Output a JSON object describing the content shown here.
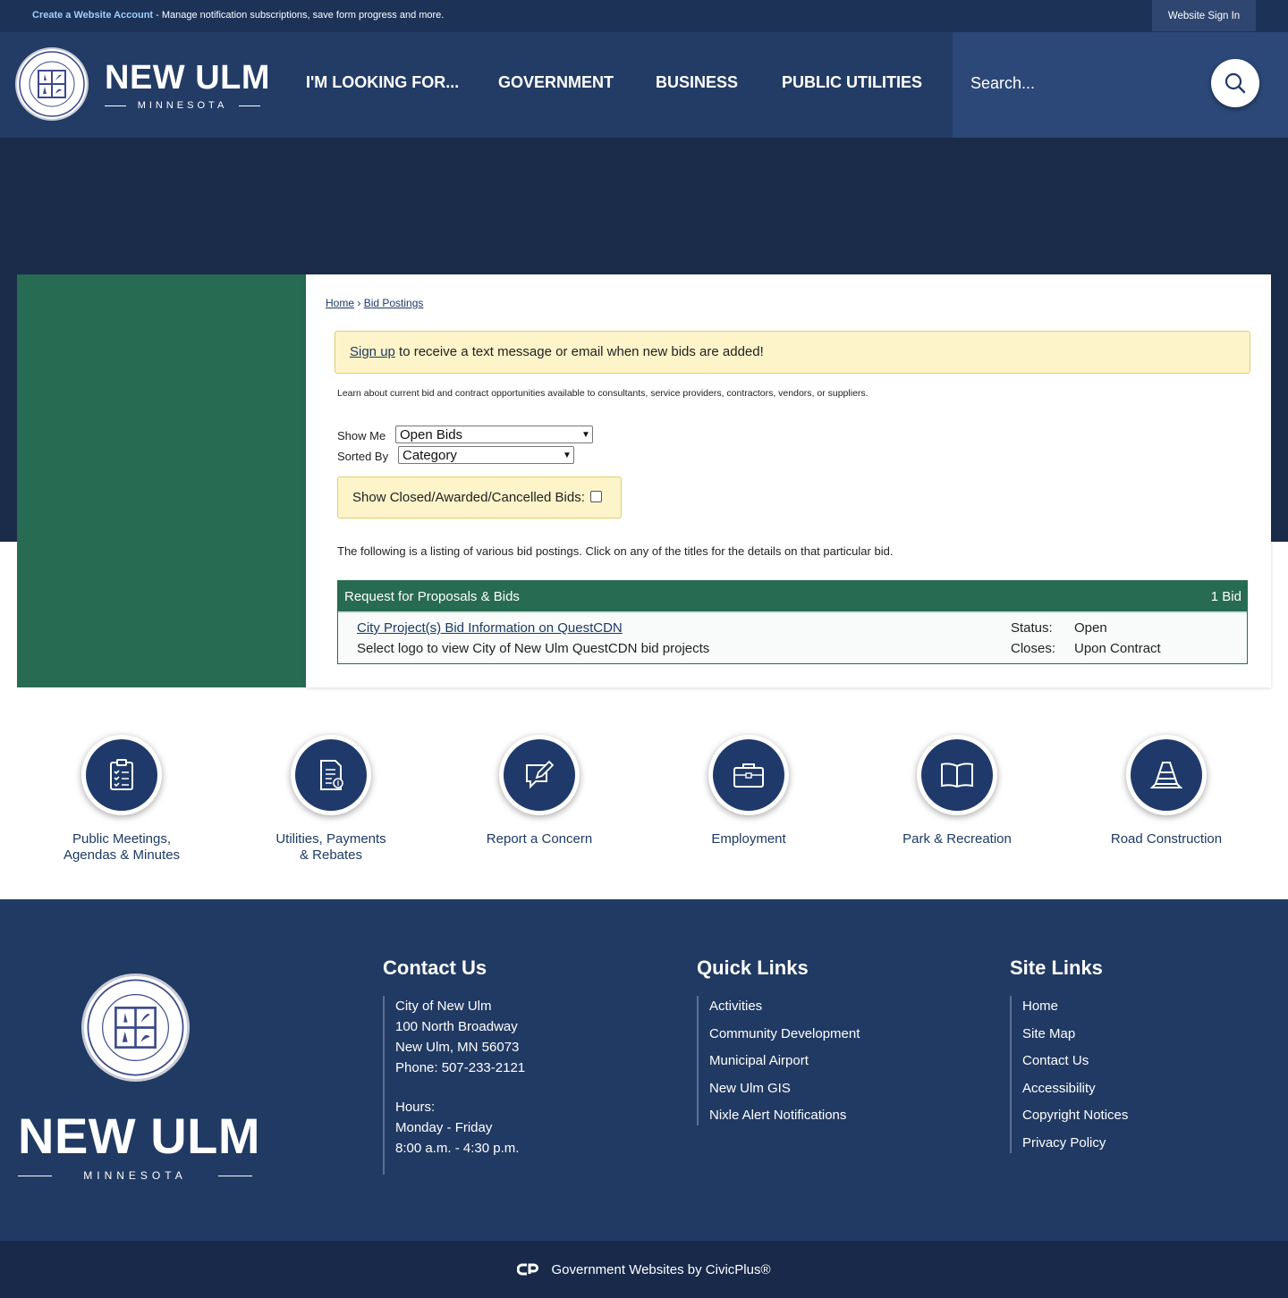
{
  "topbar": {
    "account_link": "Create a Website Account",
    "account_desc": " - Manage notification subscriptions, save form progress and more.",
    "signin": "Website Sign In"
  },
  "header": {
    "brand_name": "NEW ULM",
    "brand_sub": "MINNESOTA",
    "nav": [
      "I'M LOOKING FOR...",
      "GOVERNMENT",
      "BUSINESS",
      "PUBLIC UTILITIES"
    ],
    "search_placeholder": "Search..."
  },
  "breadcrumb": {
    "home": "Home",
    "current": "Bid Postings",
    "separator": "›"
  },
  "notice": {
    "link": "Sign up",
    "text": " to receive a text message or email when new bids are added!"
  },
  "intro": "Learn about current bid and contract opportunities available to consultants, service providers, contractors, vendors, or suppliers.",
  "filters": {
    "show_me_label": "Show Me",
    "show_me_value": "Open Bids",
    "sorted_by_label": "Sorted By",
    "sorted_by_value": "Category",
    "closed_label": "Show Closed/Awarded/Cancelled Bids:"
  },
  "listing_text": "The following is a listing of various bid postings. Click on any of the titles for the details on that particular bid.",
  "bids": {
    "category": "Request for Proposals & Bids",
    "count": "1 Bid",
    "item": {
      "title": "City Project(s) Bid Information on QuestCDN",
      "desc": "Select logo to view City of New Ulm QuestCDN bid projects",
      "status_label": "Status:",
      "status_value": "Open",
      "closes_label": "Closes:",
      "closes_value": "Upon Contract"
    }
  },
  "quick_icons": [
    {
      "line1": "Public Meetings,",
      "line2": "Agendas & Minutes",
      "icon": "clipboard-checklist-icon"
    },
    {
      "line1": "Utilities, Payments",
      "line2": "& Rebates",
      "icon": "bill-document-icon"
    },
    {
      "line1": "Report a Concern",
      "line2": "",
      "icon": "edit-message-icon"
    },
    {
      "line1": "Employment",
      "line2": "",
      "icon": "briefcase-icon"
    },
    {
      "line1": "Park & Recreation",
      "line2": "",
      "icon": "book-icon"
    },
    {
      "line1": "Road Construction",
      "line2": "",
      "icon": "traffic-cone-icon"
    }
  ],
  "footer": {
    "brand_name": "NEW ULM",
    "brand_sub": "MINNESOTA",
    "contact": {
      "heading": "Contact Us",
      "lines": [
        "City of New Ulm",
        "100 North Broadway",
        "New Ulm, MN 56073",
        "Phone: 507-233-2121"
      ],
      "hours_lines": [
        "Hours:",
        "Monday - Friday",
        "8:00 a.m. - 4:30 p.m."
      ]
    },
    "quick_links": {
      "heading": "Quick Links",
      "items": [
        "Activities",
        "Community Development",
        "Municipal Airport",
        "New Ulm GIS",
        "Nixle Alert Notifications"
      ]
    },
    "site_links": {
      "heading": "Site Links",
      "items": [
        "Home",
        "Site Map",
        "Contact Us",
        "Accessibility",
        "Copyright Notices",
        "Privacy Policy"
      ]
    }
  },
  "bottombar": {
    "text": "Government Websites by CivicPlus®"
  },
  "colors": {
    "navy": "#233c66",
    "green": "#276b52",
    "notice_bg": "#fdf4c9",
    "dark_hero": "#1b2c4a"
  }
}
